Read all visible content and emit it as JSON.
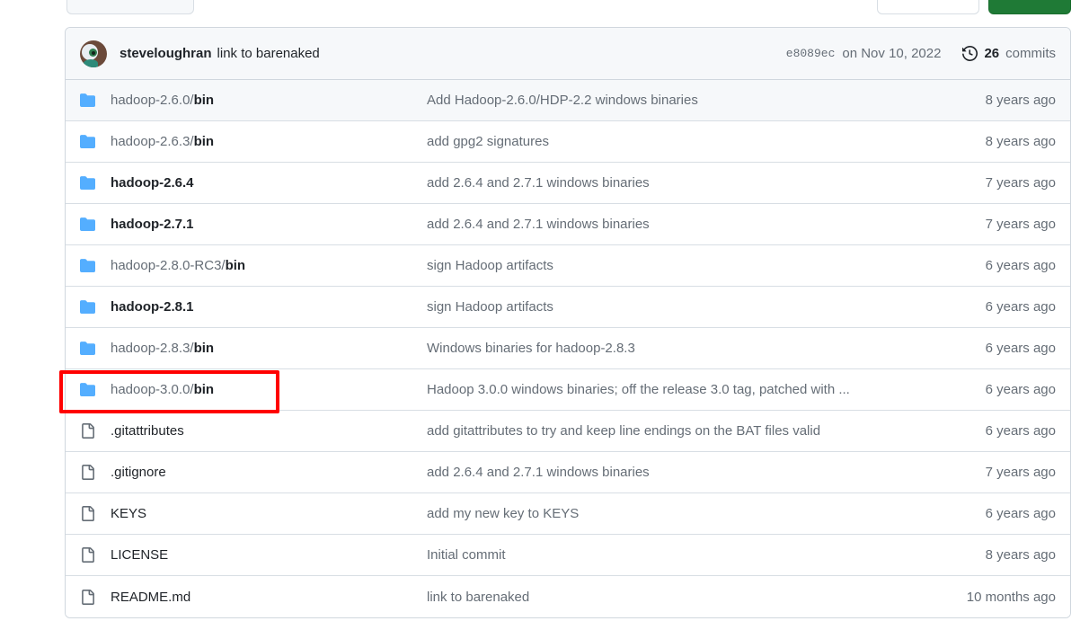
{
  "top_buttons": [
    {
      "name": "branch-button",
      "style": "muted"
    },
    {
      "name": "go-to-file-button",
      "style": "white"
    },
    {
      "name": "code-button",
      "style": "green"
    }
  ],
  "commit_header": {
    "author": "steveloughran",
    "message": "link to barenaked",
    "sha": "e8089ec",
    "date": "on Nov 10, 2022",
    "commits_count": "26",
    "commits_label": "commits",
    "history_icon": "history-icon",
    "avatar_icon": "avatar"
  },
  "colors": {
    "folder_icon": "#54aeff",
    "file_icon": "#656d76",
    "header_bg": "#f6f8fa",
    "border": "#d0d7de",
    "muted_text": "#656d76",
    "primary_text": "#1f2328",
    "highlight": "#ff0000",
    "code_button": "#1f7a36"
  },
  "rows": [
    {
      "icon": "folder-icon",
      "type": "dir",
      "name_prefix": "hadoop-2.6.0/",
      "name_suffix": "bin",
      "message": "Add Hadoop-2.6.0/HDP-2.2 windows binaries",
      "age": "8 years ago",
      "tinted": true,
      "highlighted": false
    },
    {
      "icon": "folder-icon",
      "type": "dir",
      "name_prefix": "hadoop-2.6.3/",
      "name_suffix": "bin",
      "message": "add gpg2 signatures",
      "age": "8 years ago",
      "tinted": false,
      "highlighted": false
    },
    {
      "icon": "folder-icon",
      "type": "dir",
      "name_prefix": "",
      "name_suffix": "hadoop-2.6.4",
      "message": "add 2.6.4 and 2.7.1 windows binaries",
      "age": "7 years ago",
      "tinted": false,
      "highlighted": false
    },
    {
      "icon": "folder-icon",
      "type": "dir",
      "name_prefix": "",
      "name_suffix": "hadoop-2.7.1",
      "message": "add 2.6.4 and 2.7.1 windows binaries",
      "age": "7 years ago",
      "tinted": false,
      "highlighted": false
    },
    {
      "icon": "folder-icon",
      "type": "dir",
      "name_prefix": "hadoop-2.8.0-RC3/",
      "name_suffix": "bin",
      "message": "sign Hadoop artifacts",
      "age": "6 years ago",
      "tinted": false,
      "highlighted": false
    },
    {
      "icon": "folder-icon",
      "type": "dir",
      "name_prefix": "",
      "name_suffix": "hadoop-2.8.1",
      "message": "sign Hadoop artifacts",
      "age": "6 years ago",
      "tinted": false,
      "highlighted": false
    },
    {
      "icon": "folder-icon",
      "type": "dir",
      "name_prefix": "hadoop-2.8.3/",
      "name_suffix": "bin",
      "message": "Windows binaries for hadoop-2.8.3",
      "age": "6 years ago",
      "tinted": false,
      "highlighted": false
    },
    {
      "icon": "folder-icon",
      "type": "dir",
      "name_prefix": "hadoop-3.0.0/",
      "name_suffix": "bin",
      "message": "Hadoop 3.0.0 windows binaries; off the release 3.0 tag, patched with ...",
      "age": "6 years ago",
      "tinted": false,
      "highlighted": true
    },
    {
      "icon": "file-icon",
      "type": "file",
      "name_prefix": "",
      "name_suffix": ".gitattributes",
      "message": "add gitattributes to try and keep line endings on the BAT files valid",
      "age": "6 years ago",
      "tinted": false,
      "highlighted": false
    },
    {
      "icon": "file-icon",
      "type": "file",
      "name_prefix": "",
      "name_suffix": ".gitignore",
      "message": "add 2.6.4 and 2.7.1 windows binaries",
      "age": "7 years ago",
      "tinted": false,
      "highlighted": false
    },
    {
      "icon": "file-icon",
      "type": "file",
      "name_prefix": "",
      "name_suffix": "KEYS",
      "message": "add my new key to KEYS",
      "age": "6 years ago",
      "tinted": false,
      "highlighted": false
    },
    {
      "icon": "file-icon",
      "type": "file",
      "name_prefix": "",
      "name_suffix": "LICENSE",
      "message": "Initial commit",
      "age": "8 years ago",
      "tinted": false,
      "highlighted": false
    },
    {
      "icon": "file-icon",
      "type": "file",
      "name_prefix": "",
      "name_suffix": "README.md",
      "message": "link to barenaked",
      "age": "10 months ago",
      "tinted": false,
      "highlighted": false
    }
  ]
}
